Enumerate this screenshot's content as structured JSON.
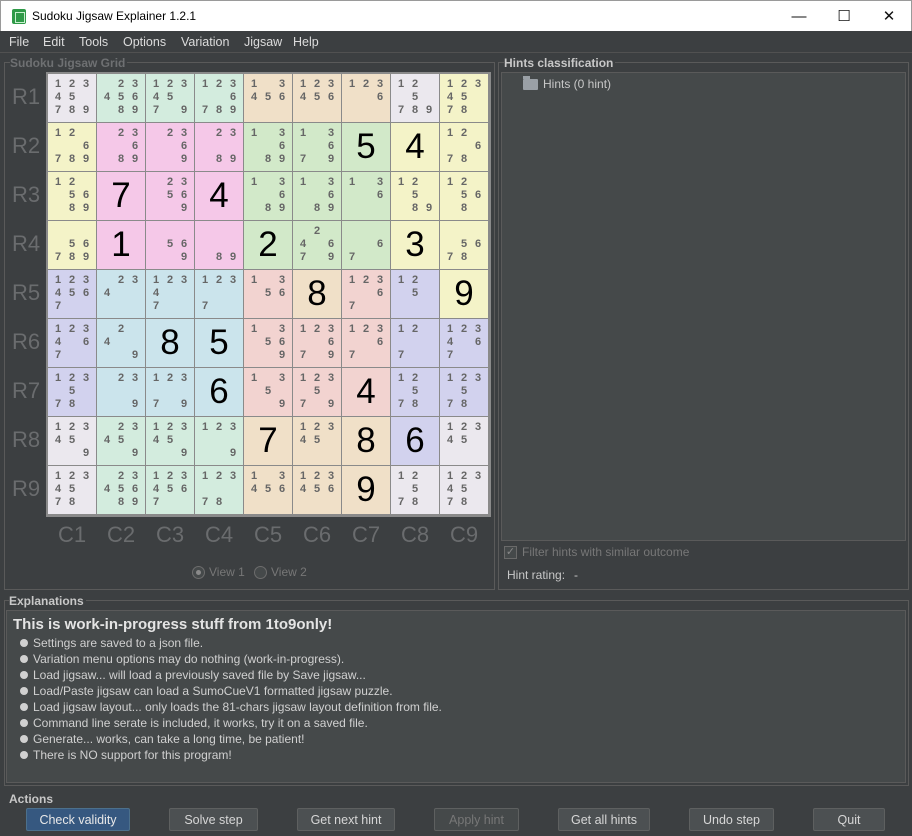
{
  "window": {
    "title": "Sudoku Jigsaw Explainer 1.2.1",
    "minimize": "—",
    "maximize": "☐",
    "close": "✕"
  },
  "menu": [
    "File",
    "Edit",
    "Tools",
    "Options",
    "Variation",
    "Jigsaw",
    "Help"
  ],
  "grid_panel": {
    "title": "Sudoku Jigsaw Grid",
    "row_labels": [
      "R1",
      "R2",
      "R3",
      "R4",
      "R5",
      "R6",
      "R7",
      "R8",
      "R9"
    ],
    "col_labels": [
      "C1",
      "C2",
      "C3",
      "C4",
      "C5",
      "C6",
      "C7",
      "C8",
      "C9"
    ],
    "view1": "View 1",
    "view2": "View 2"
  },
  "region_colors": {
    "A": "#ebe8ee",
    "B": "#d3ecde",
    "C": "#f5c8e8",
    "D": "#f0e0c8",
    "E": "#f4f3c8",
    "F": "#d2e9c9",
    "G": "#cbe4ec",
    "H": "#f2d3d0",
    "I": "#d2d2ee"
  },
  "regions": [
    "ABBBDDDAE",
    "ECCCFFFEE",
    "ECCCFFFEE",
    "ECCCFFFEE",
    "IGGGHDHIE",
    "IGGGHHHII",
    "IGGGHHHII",
    "ABBBDDDIA",
    "ABBBDDDAA"
  ],
  "cells": [
    [
      "12345789",
      "2345689",
      "1234579",
      "1236789",
      "13456",
      "123456",
      "1236",
      "125789",
      "1234578"
    ],
    [
      "1/2/6/7/8/9",
      "23689",
      "2369",
      "2389",
      "13689",
      "13679",
      "5",
      "4",
      "12678"
    ],
    [
      "125689",
      "7",
      "23569",
      "4",
      "13689",
      "13689",
      "136",
      "12589",
      "12568"
    ],
    [
      "56789",
      "1",
      "569",
      "89",
      "2",
      "46792",
      "67",
      "3",
      "5678"
    ],
    [
      "1234567",
      "234",
      "12347",
      "1237",
      "1356",
      "8",
      "12367",
      "125",
      "9"
    ],
    [
      "124673",
      "249",
      "8",
      "5",
      "13569",
      "123679",
      "12367",
      "127",
      "123467"
    ],
    [
      "12357 8",
      "239",
      "12379",
      "6",
      "1359",
      "123579",
      "4",
      "12578",
      "12357 8"
    ],
    [
      "123459",
      "23459",
      "123459",
      "1239",
      "7",
      "12345",
      "8",
      "6",
      "12345"
    ],
    [
      "1234578",
      "2345689",
      "1234567",
      "12378",
      "13456",
      "123456",
      "9",
      "12578",
      "1234578"
    ]
  ],
  "hints_panel": {
    "title": "Hints classification",
    "root": "Hints (0 hint)",
    "filter": "Filter hints with similar outcome",
    "rating_label": "Hint rating:",
    "rating_value": "-"
  },
  "explanations": {
    "title": "Explanations",
    "heading": "This is work-in-progress stuff from 1to9only!",
    "bullets": [
      "Settings are saved to a json file.",
      "Variation menu options may do nothing (work-in-progress).",
      "Load jigsaw... will load a previously saved file by Save jigsaw...",
      "Load/Paste jigsaw can load a SumoCueV1 formatted jigsaw puzzle.",
      "Load jigsaw layout... only loads the 81-chars jigsaw layout definition from file.",
      "Command line serate is included, it works, try it on a saved file.",
      "Generate... works, can take a long time, be patient!",
      "There is NO support for this program!"
    ]
  },
  "actions": {
    "title": "Actions",
    "buttons": [
      "Check validity",
      "Solve step",
      "Get next hint",
      "Apply hint",
      "Get all hints",
      "Undo step",
      "Quit"
    ]
  }
}
